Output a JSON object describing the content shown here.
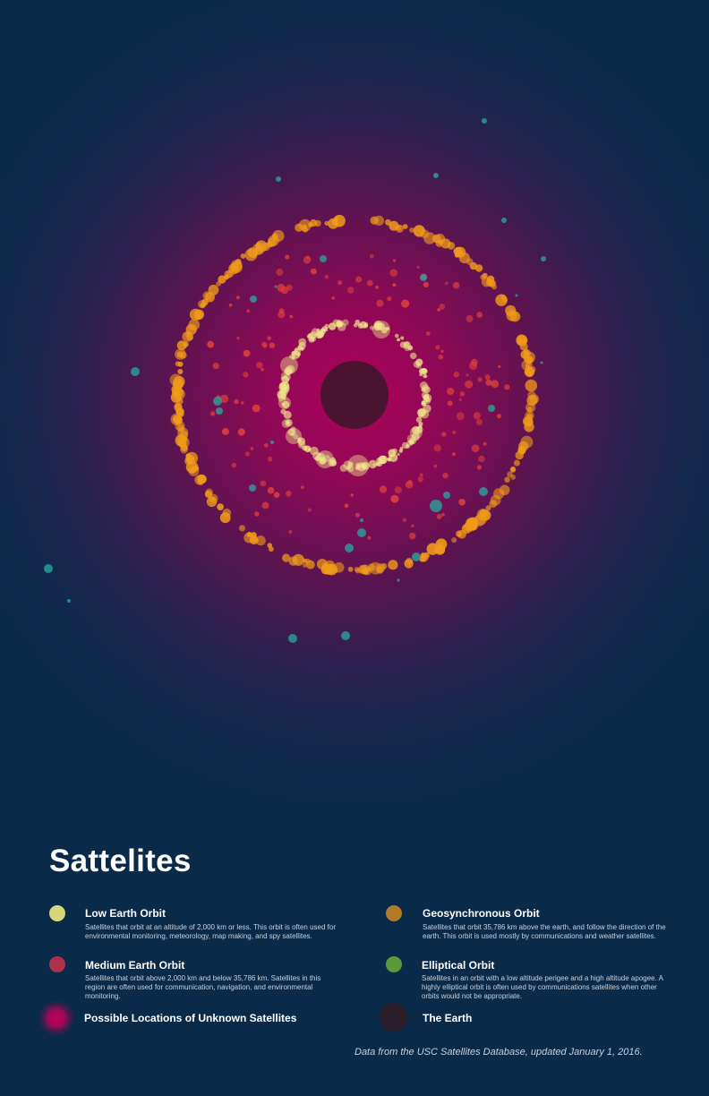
{
  "title": "Sattelites",
  "colors": {
    "background": "#0a2a4a",
    "leo": "#efe38a",
    "meo": "#e0403a",
    "geo": "#f09a1a",
    "elliptical": "#2aa39a",
    "earth": "#4a1430",
    "unknown_glow": "#b0005a"
  },
  "legend": [
    {
      "key": "leo",
      "label": "Low Earth Orbit",
      "description": "Satellites that orbit at an altitude of 2,000 km or less. This orbit is often used for environmental monitoring, meteorology, map making, and spy satellites.",
      "swatch_color": "#d6d67a"
    },
    {
      "key": "geo",
      "label": "Geosynchronous Orbit",
      "description": "Satellites that orbit 35,786 km above the earth, and follow the direction of the earth. This orbit is used mostly by communications and weather satellites.",
      "swatch_color": "#b07a2a"
    },
    {
      "key": "meo",
      "label": "Medium Earth Orbit",
      "description": "Satellites that orbit above 2,000 km and below 35,786 km. Satellites in this region are often used for communication, navigation, and environmental monitoring.",
      "swatch_color": "#b0304a"
    },
    {
      "key": "elliptical",
      "label": "Elliptical Orbit",
      "description": "Satellites in an orbit with a low altitude perigee and a high altitude apogee. A highly elliptical orbit is often used by communications satellites when other orbits would not be appropriate.",
      "swatch_color": "#5a9a3a"
    },
    {
      "key": "unknown",
      "label": "Possible Locations of Unknown Satellites",
      "description": "",
      "swatch_color": "#b0005a"
    },
    {
      "key": "earth",
      "label": "The Earth",
      "description": "",
      "swatch_color": "#2a1f2a"
    }
  ],
  "source_note": "Data from  the USC Satellites Database, updated January 1, 2016."
}
